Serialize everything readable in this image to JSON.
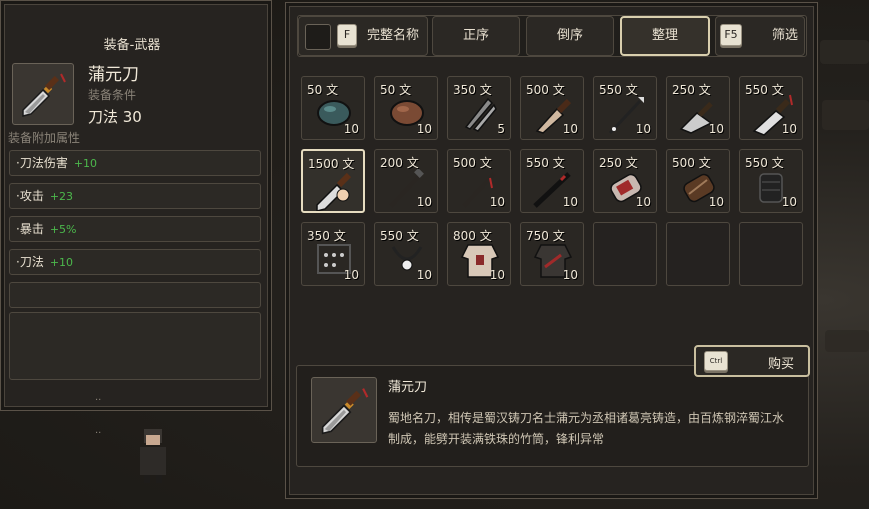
{
  "equip_panel": {
    "title": "装备-武器",
    "item_name": "蒲元刀",
    "requirement_label": "装备条件",
    "requirement": "刀法 30",
    "bonus_label": "装备附加属性",
    "bonuses": [
      {
        "name": "·刀法伤害",
        "value": "+10"
      },
      {
        "name": "·攻击",
        "value": "+23"
      },
      {
        "name": "·暴击",
        "value": "+5%"
      },
      {
        "name": "·刀法",
        "value": "+10"
      }
    ],
    "dots_1": "..",
    "dots_2": ".."
  },
  "toolbar": {
    "full_name_key": "F",
    "full_name_label": "完整名称",
    "asc_label": "正序",
    "desc_label": "倒序",
    "sort_label": "整理",
    "filter_key": "F5",
    "filter_label": "筛选"
  },
  "items": [
    {
      "price": "50 文",
      "qty": "10",
      "icon": "ore-teal-icon"
    },
    {
      "price": "50 文",
      "qty": "10",
      "icon": "ore-brown-icon"
    },
    {
      "price": "350 文",
      "qty": "5",
      "icon": "throwing-knives-icon"
    },
    {
      "price": "500 文",
      "qty": "10",
      "icon": "dagger-icon"
    },
    {
      "price": "550 文",
      "qty": "10",
      "icon": "spear-icon"
    },
    {
      "price": "250 文",
      "qty": "10",
      "icon": "cleaver-icon"
    },
    {
      "price": "550 文",
      "qty": "10",
      "icon": "broadsword-icon"
    },
    {
      "price": "1500 文",
      "qty": "",
      "icon": "puyuan-blade-icon"
    },
    {
      "price": "200 文",
      "qty": "10",
      "icon": "staff-icon"
    },
    {
      "price": "500 文",
      "qty": "10",
      "icon": "tasseled-staff-icon"
    },
    {
      "price": "550 文",
      "qty": "10",
      "icon": "black-staff-icon"
    },
    {
      "price": "250 文",
      "qty": "10",
      "icon": "bracer-red-icon"
    },
    {
      "price": "500 文",
      "qty": "10",
      "icon": "bracer-brown-icon"
    },
    {
      "price": "550 文",
      "qty": "10",
      "icon": "bracer-black-icon"
    },
    {
      "price": "350 文",
      "qty": "10",
      "icon": "abacus-icon"
    },
    {
      "price": "550 文",
      "qty": "10",
      "icon": "bead-necklace-icon"
    },
    {
      "price": "800 文",
      "qty": "10",
      "icon": "robe-icon"
    },
    {
      "price": "750 文",
      "qty": "10",
      "icon": "armor-icon"
    }
  ],
  "detail": {
    "name": "蒲元刀",
    "description": "蜀地名刀，相传是蜀汉铸刀名士蒲元为丞相诸葛亮铸造，由百炼钢淬蜀江水制成，能劈开装满铁珠的竹筒，锋利异常"
  },
  "buy": {
    "key": "Ctrl",
    "label": "购买"
  },
  "colors": {
    "bonus_value": "#4cb84c",
    "selected_border": "#e6dcc0"
  }
}
